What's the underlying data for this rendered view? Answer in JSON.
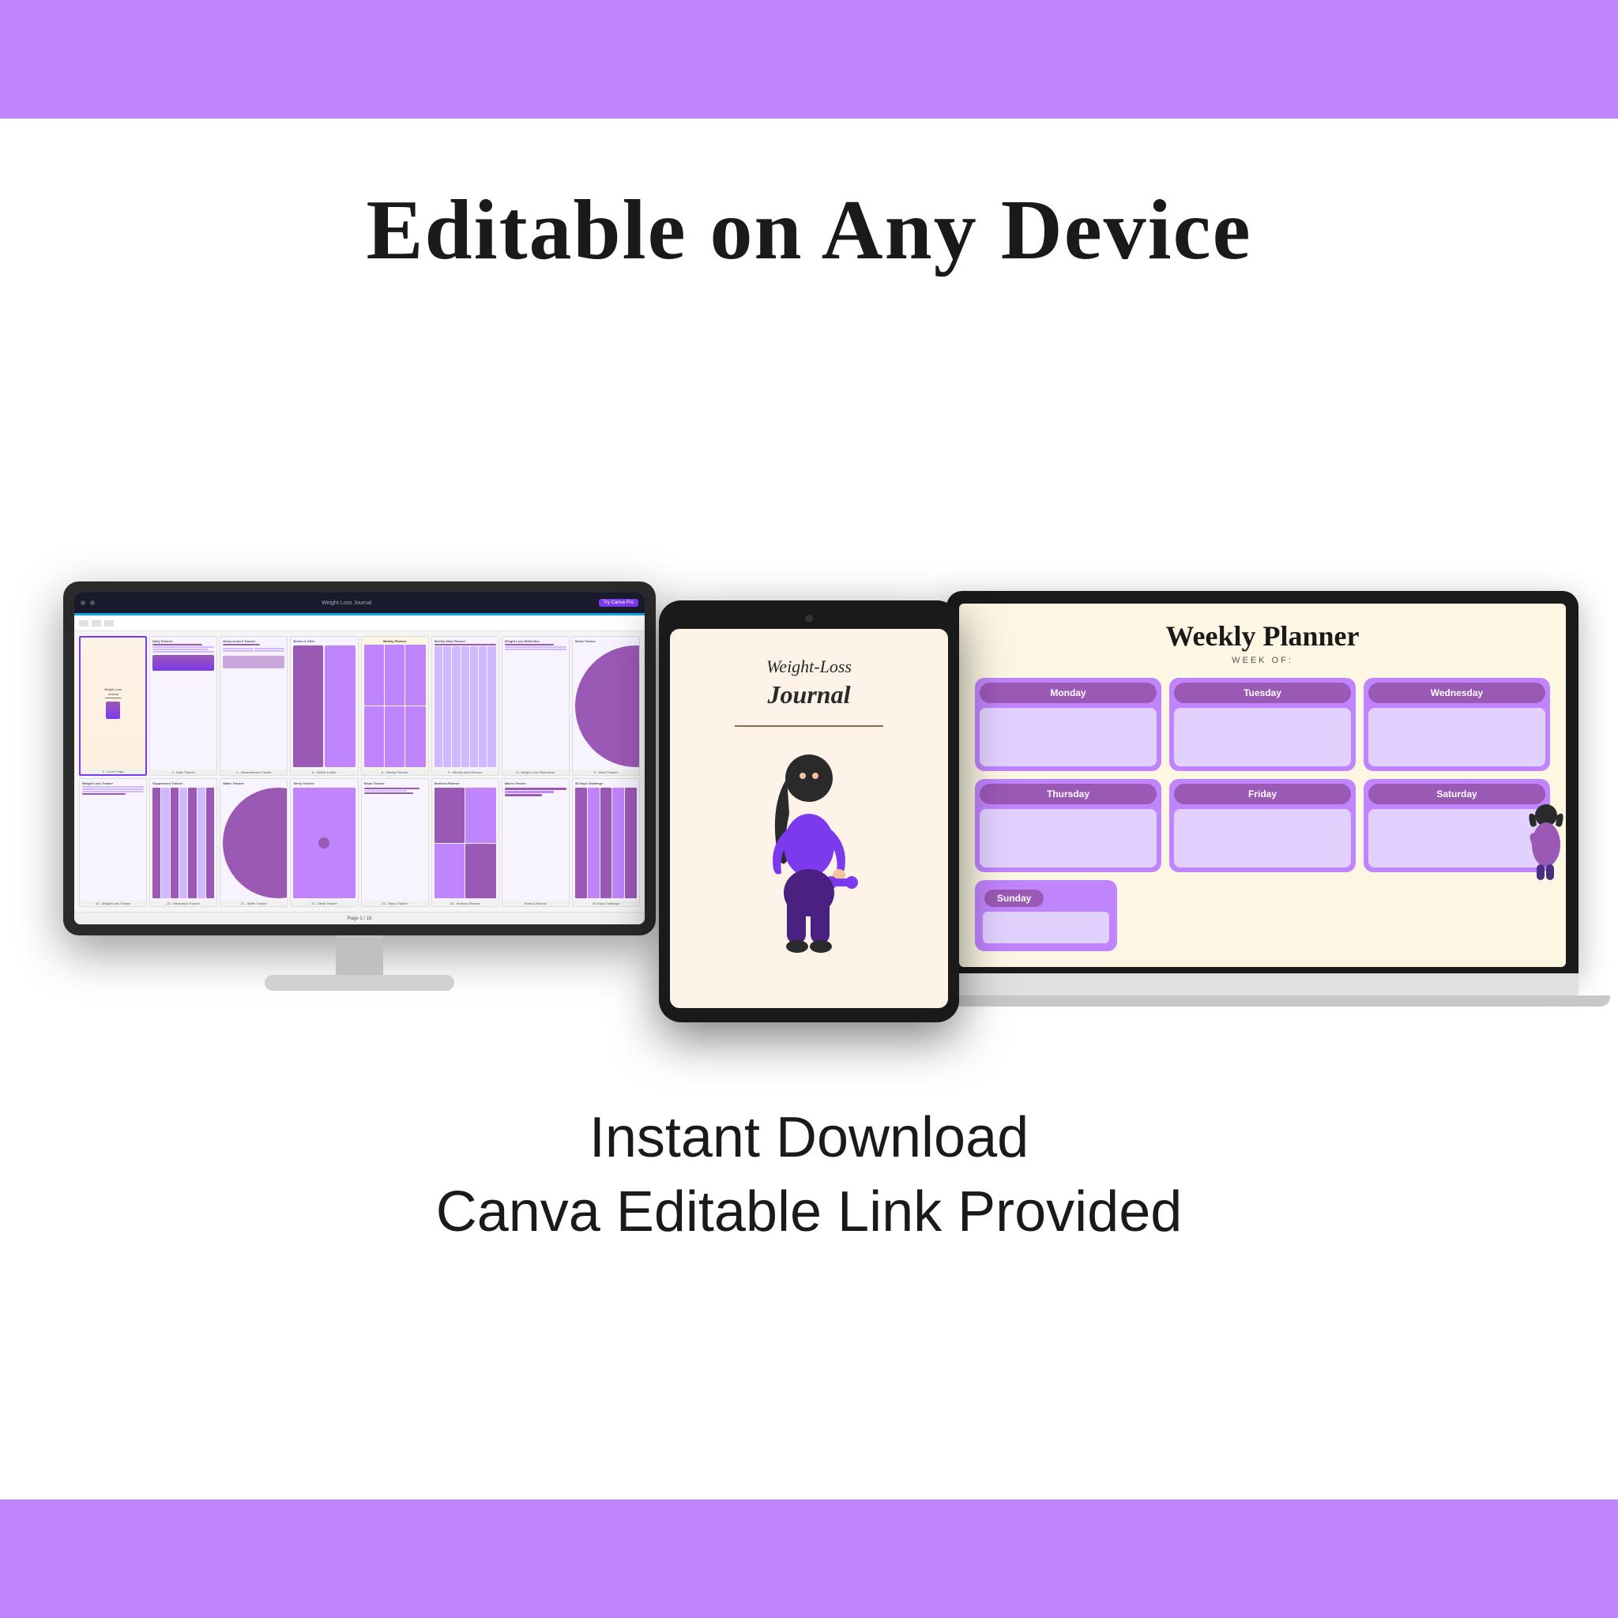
{
  "page": {
    "background_color": "#c084fc",
    "white_bg_color": "#ffffff"
  },
  "header": {
    "title": "Editable on Any Device"
  },
  "weekly_planner": {
    "title": "Weekly Planner",
    "week_of_label": "WEEK OF:",
    "days": [
      "Monday",
      "Tuesday",
      "Wednesday",
      "Thursday",
      "Friday",
      "Saturday",
      "Sunday"
    ]
  },
  "tablet_journal": {
    "title_line1": "Weight-Loss",
    "title_line2": "Journal"
  },
  "footer": {
    "line1": "Instant Download",
    "line2": "Canva Editable Link Provided"
  },
  "canva_screen": {
    "title": "Weight Loss Journal",
    "subtitle": "Try Canva Pro",
    "page_label": "Page 1 / 18"
  },
  "page_thumbnails": [
    {
      "label": "Weight Loss Journal"
    },
    {
      "label": "Daily Planner"
    },
    {
      "label": "Measurement Tracker"
    },
    {
      "label": "Before & After"
    },
    {
      "label": "Weekly Planner"
    },
    {
      "label": "Weekly Meal Planner"
    },
    {
      "label": "Weight Loss Reflection"
    },
    {
      "label": "Mood Tracker"
    },
    {
      "label": "Weight Loss Tracker"
    },
    {
      "label": "Supplement Tracker"
    },
    {
      "label": "Water Tracker"
    },
    {
      "label": "Sleep Tracker"
    },
    {
      "label": "Steps Tracker"
    },
    {
      "label": "Workout Planner"
    },
    {
      "label": "Macros & Notes"
    },
    {
      "label": "30 Days Challenge"
    }
  ]
}
